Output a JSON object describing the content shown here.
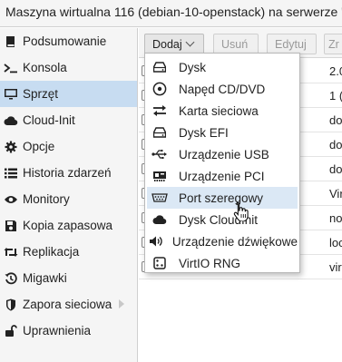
{
  "window": {
    "title": "Maszyna wirtualna 116 (debian-10-openstack) na serwerze 'proxm"
  },
  "sidebar": {
    "items": [
      {
        "label": "Podsumowanie",
        "icon": "book-icon",
        "active": false
      },
      {
        "label": "Konsola",
        "icon": "terminal-icon",
        "active": false
      },
      {
        "label": "Sprzęt",
        "icon": "monitor-icon",
        "active": true
      },
      {
        "label": "Cloud-Init",
        "icon": "cloud-icon",
        "active": false
      },
      {
        "label": "Opcje",
        "icon": "gear-icon",
        "active": false
      },
      {
        "label": "Historia zdarzeń",
        "icon": "list-icon",
        "active": false
      },
      {
        "label": "Monitory",
        "icon": "eye-icon",
        "active": false
      },
      {
        "label": "Kopia zapasowa",
        "icon": "floppy-icon",
        "active": false
      },
      {
        "label": "Replikacja",
        "icon": "retweet-icon",
        "active": false
      },
      {
        "label": "Migawki",
        "icon": "history-icon",
        "active": false
      },
      {
        "label": "Zapora sieciowa",
        "icon": "shield-icon",
        "active": false,
        "has_submenu": true
      },
      {
        "label": "Uprawnienia",
        "icon": "unlock-icon",
        "active": false
      }
    ]
  },
  "toolbar": {
    "add_label": "Dodaj",
    "remove_label": "Usuń",
    "edit_label": "Edytuj",
    "next_label": "Zr"
  },
  "grid": {
    "values": [
      "2.0",
      "1 (",
      "do",
      "do",
      "do",
      "Vir",
      "no",
      "loc",
      "vir"
    ]
  },
  "add_menu": {
    "items": [
      {
        "label": "Dysk",
        "icon": "hdd-icon"
      },
      {
        "label": "Napęd CD/DVD",
        "icon": "cdrom-icon"
      },
      {
        "label": "Karta sieciowa",
        "icon": "exchange-icon"
      },
      {
        "label": "Dysk EFI",
        "icon": "hdd-icon"
      },
      {
        "label": "Urządzenie USB",
        "icon": "usb-icon"
      },
      {
        "label": "Urządzenie PCI",
        "icon": "pci-card-icon"
      },
      {
        "label": "Port szeregowy",
        "icon": "serial-port-icon",
        "highlighted": true
      },
      {
        "label": "Dysk CloudInit",
        "icon": "cloud-icon"
      },
      {
        "label": "Urządzenie dźwiękowe",
        "icon": "volume-icon"
      },
      {
        "label": "VirtIO RNG",
        "icon": "dice-icon"
      }
    ]
  },
  "colors": {
    "selection": "#c7dcf1",
    "menu_highlight": "#dbe8f5",
    "panel_bg": "#f5f5f5"
  }
}
